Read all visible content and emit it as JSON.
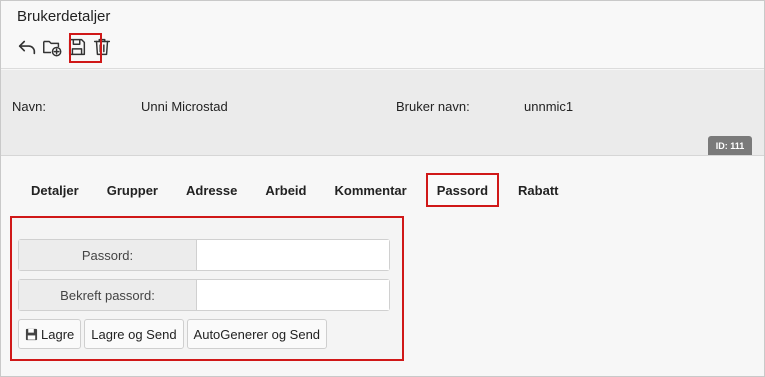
{
  "page": {
    "title": "Brukerdetaljer"
  },
  "toolbar": {
    "buttons": [
      {
        "icon": "undo-icon"
      },
      {
        "icon": "new-folder-icon"
      },
      {
        "icon": "save-icon"
      },
      {
        "icon": "trash-icon"
      }
    ]
  },
  "info": {
    "name_label": "Navn:",
    "name_value": "Unni Microstad",
    "username_label": "Bruker navn:",
    "username_value": "unnmic1",
    "id_badge": "ID: 111"
  },
  "tabs": [
    {
      "label": "Detaljer"
    },
    {
      "label": "Grupper"
    },
    {
      "label": "Adresse"
    },
    {
      "label": "Arbeid"
    },
    {
      "label": "Kommentar"
    },
    {
      "label": "Passord"
    },
    {
      "label": "Rabatt"
    }
  ],
  "active_tab": "Passord",
  "password_form": {
    "password_label": "Passord:",
    "password_value": "",
    "confirm_label": "Bekreft passord:",
    "confirm_value": "",
    "save_label": "Lagre",
    "save_send_label": "Lagre og Send",
    "autogen_label": "AutoGenerer og Send"
  },
  "colors": {
    "highlight": "#d01818",
    "badge": "#7a7a7a"
  }
}
